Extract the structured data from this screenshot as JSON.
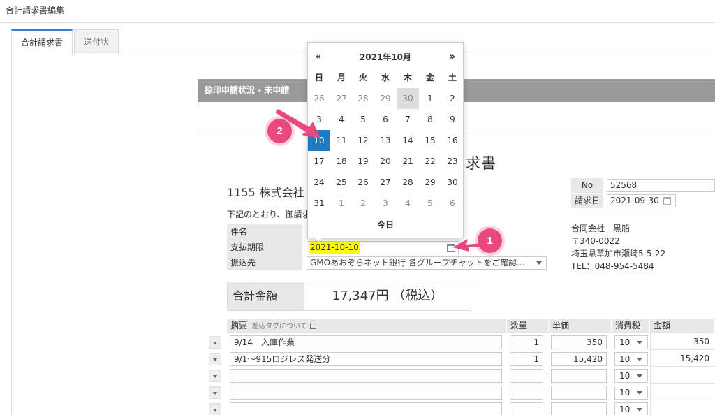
{
  "page": {
    "title": "合計請求書編集"
  },
  "tabs": [
    {
      "label": "合計請求書"
    },
    {
      "label": "送付状"
    }
  ],
  "status_bar": {
    "text": "捺印申請状況 - 未申請"
  },
  "document": {
    "title": "請求書",
    "client_number": "1155",
    "client_name": "株式会社",
    "intro": "下記のとおり、御請求",
    "labels": {
      "subject": "件名",
      "due_date": "支払期限",
      "bank": "振込先"
    },
    "due_date_value": "2021-10-10",
    "bank_value": "GMOあおぞらネット銀行 各グループチャットをご確認...",
    "no_label": "No",
    "no_value": "52568",
    "invoice_date_label": "請求日",
    "invoice_date_value": "2021-09-30",
    "company": {
      "name": "合同会社　黒船",
      "postal": "〒340-0022",
      "address": "埼玉県草加市瀬崎5-5-22",
      "tel": "TEL：048-954-5484"
    },
    "total_label": "合計金額",
    "total_value": "17,347円 （税込）"
  },
  "items_table": {
    "headers": {
      "summary": "摘要",
      "tag_link": "差込タグについて",
      "qty": "数量",
      "unit_price": "単価",
      "tax": "消費税",
      "amount": "金額"
    },
    "rows": [
      {
        "summary": "9/14　入庫作業",
        "qty": "1",
        "unit_price": "350",
        "tax": "10",
        "amount": "350"
      },
      {
        "summary": "9/1～915ロジレス発送分",
        "qty": "1",
        "unit_price": "15,420",
        "tax": "10",
        "amount": "15,420"
      },
      {
        "summary": "",
        "qty": "",
        "unit_price": "",
        "tax": "10",
        "amount": ""
      },
      {
        "summary": "",
        "qty": "",
        "unit_price": "",
        "tax": "10",
        "amount": ""
      },
      {
        "summary": "",
        "qty": "",
        "unit_price": "",
        "tax": "10",
        "amount": ""
      }
    ]
  },
  "calendar": {
    "prev": "«",
    "next": "»",
    "title": "2021年10月",
    "weekdays": [
      "日",
      "月",
      "火",
      "水",
      "木",
      "金",
      "土"
    ],
    "weeks": [
      [
        "26",
        "27",
        "28",
        "29",
        "30",
        "1",
        "2"
      ],
      [
        "3",
        "4",
        "5",
        "6",
        "7",
        "8",
        "9"
      ],
      [
        "10",
        "11",
        "12",
        "13",
        "14",
        "15",
        "16"
      ],
      [
        "17",
        "18",
        "19",
        "20",
        "21",
        "22",
        "23"
      ],
      [
        "24",
        "25",
        "26",
        "27",
        "28",
        "29",
        "30"
      ],
      [
        "31",
        "1",
        "2",
        "3",
        "4",
        "5",
        "6"
      ]
    ],
    "today_button": "今日"
  },
  "callouts": [
    {
      "label": "1"
    },
    {
      "label": "2"
    }
  ],
  "colors": {
    "accent": "#1e79c0",
    "highlight": "#ffff00",
    "callout": "#e8487e",
    "status_bar": "#9a9a9a"
  }
}
